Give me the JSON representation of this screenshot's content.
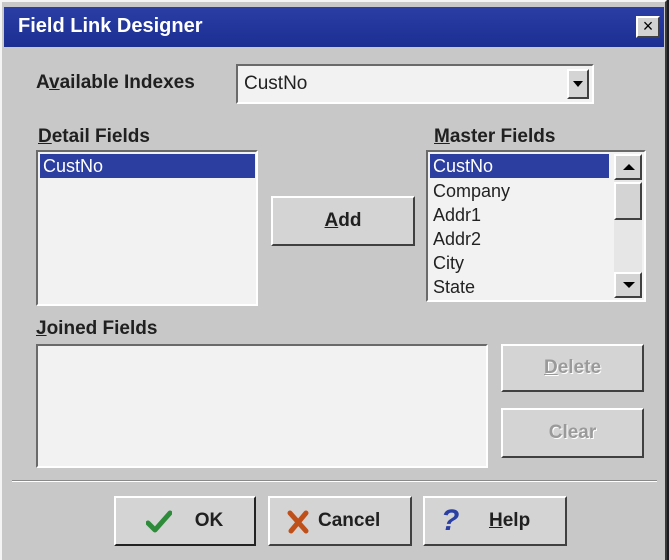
{
  "window": {
    "title": "Field Link Designer",
    "close_label": "×"
  },
  "available_indexes": {
    "label_pre": "A",
    "label_key": "v",
    "label_post": "ailable Indexes",
    "value": "CustNo"
  },
  "detail_fields": {
    "label_key": "D",
    "label_post": "etail Fields",
    "items": [
      "CustNo"
    ],
    "selected": "CustNo"
  },
  "master_fields": {
    "label_key": "M",
    "label_post": "aster Fields",
    "items": [
      "CustNo",
      "Company",
      "Addr1",
      "Addr2",
      "City",
      "State"
    ],
    "selected": "CustNo"
  },
  "add_button": {
    "key": "A",
    "rest": "dd"
  },
  "joined_fields": {
    "label_key": "J",
    "label_post": "oined Fields",
    "items": []
  },
  "delete_button": {
    "key": "D",
    "rest": "elete",
    "enabled": false
  },
  "clear_button": {
    "label": "Clear",
    "enabled": false
  },
  "footer": {
    "ok_label": "OK",
    "cancel_label": "Cancel",
    "help_key": "H",
    "help_rest": "elp"
  },
  "colors": {
    "titlebar": "#1c2e92",
    "selection": "#2c3ea0",
    "dialog_bg": "#c8c8c8",
    "ok_check": "#2e8b3a",
    "cancel_x": "#c0501a",
    "help_q": "#2a3ea4"
  },
  "icons": {
    "ok": "checkmark-icon",
    "cancel": "x-cross-icon",
    "help": "question-mark-icon"
  }
}
